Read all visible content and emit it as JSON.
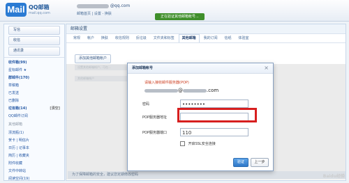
{
  "header": {
    "logo_letters": "Mail",
    "logo_title": "QQ邮箱",
    "logo_domain": "mail.qq.com",
    "account_suffix": "@qq.com",
    "links": "邮箱首页 | 设置 - 换肤",
    "notice": "正在验证其他邮箱帐号...",
    "right_links": ""
  },
  "sidebar": {
    "compose": "写信",
    "receive": "收信",
    "contacts": "通讯录",
    "items": [
      {
        "label": "收件箱(99)",
        "bold": true
      },
      {
        "label": "星标邮件 ★",
        "bold": false
      },
      {
        "label": "群邮件(170)",
        "bold": true
      },
      {
        "label": "草稿箱",
        "bold": false
      },
      {
        "label": "已发送",
        "bold": false
      },
      {
        "label": "已删除",
        "bold": false
      },
      {
        "label": "垃圾箱(14)",
        "bold": true
      },
      {
        "label": "QQ邮件订阅",
        "bold": false
      }
    ],
    "clear": "[清空]",
    "group_other": "其他邮箱",
    "bottom_items": [
      {
        "label": "漂流瓶(1)",
        "bold": false
      },
      {
        "label": "贺卡 | 明信片",
        "bold": false
      },
      {
        "label": "日历 | 记事本",
        "bold": false
      },
      {
        "label": "简历 | 收藏夹",
        "bold": false
      },
      {
        "label": "附件收藏",
        "bold": false
      },
      {
        "label": "文件中转站",
        "bold": false
      },
      {
        "label": "阅读空间(19)",
        "bold": false
      }
    ]
  },
  "main": {
    "title": "邮箱设置",
    "tabs": [
      {
        "label": "常规",
        "active": false
      },
      {
        "label": "帐户",
        "active": false
      },
      {
        "label": "换肤",
        "active": false
      },
      {
        "label": "收信规则",
        "active": false
      },
      {
        "label": "反垃圾",
        "active": false
      },
      {
        "label": "文件夹和标签",
        "active": false
      },
      {
        "label": "其他邮箱",
        "active": true
      },
      {
        "label": "我的订阅",
        "active": false
      },
      {
        "label": "信纸",
        "active": false
      },
      {
        "label": "体验室",
        "active": false
      }
    ],
    "add_account_button": "添加其他邮箱帐户",
    "faint_row_1": "设置其他邮箱帐户，可在...",
    "faint_row_2": "其他邮箱帐户",
    "footer": "为了保障邮箱的安全，建议您定期修改密码"
  },
  "dialog": {
    "title": "添加邮箱帐号",
    "close_icon": "close-icon",
    "intro": "请输入接收邮件服务器(POP)",
    "email_middle": "@",
    "email_suffix": ".com",
    "password_label": "密码",
    "password_value": "••••••••",
    "pop_server_label": "POP服务器地址",
    "pop_server_value": "",
    "pop_port_label": "POP服务器端口",
    "pop_port_value": "110",
    "ssl_label": "开启SSL安全连接",
    "confirm_button": "验证",
    "back_button": "上一步"
  },
  "watermark": "Baidu经验"
}
